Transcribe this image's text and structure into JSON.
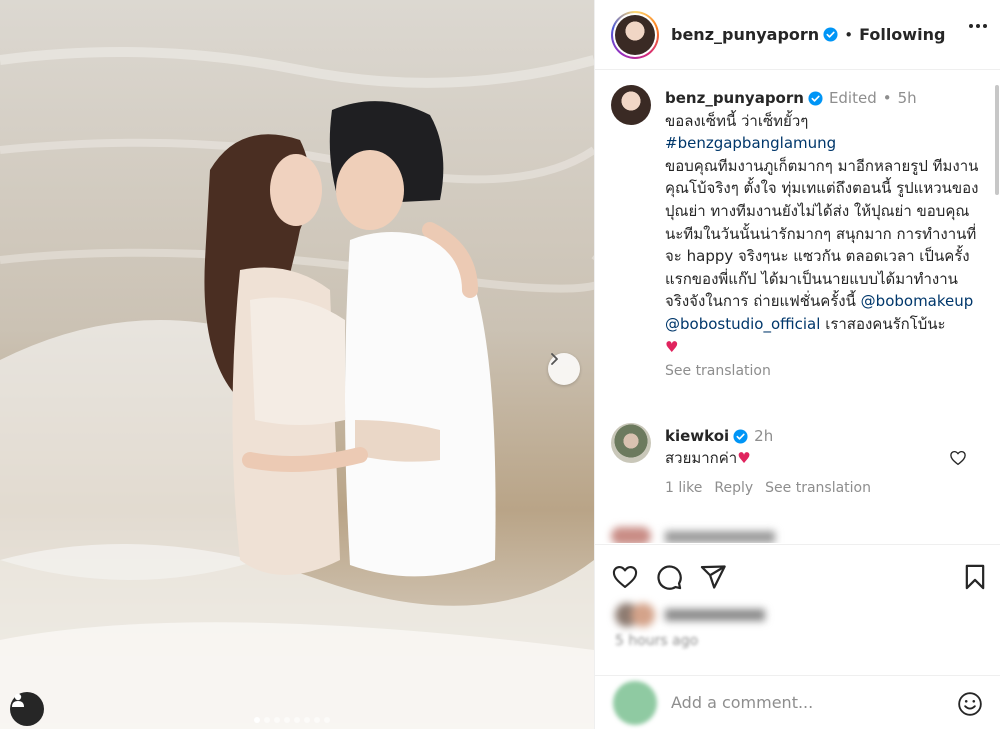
{
  "post": {
    "author": "benz_punyaporn",
    "follow_status": "Following",
    "separator": "•",
    "photo_dots_count": 8,
    "photo_active_dot": 0
  },
  "caption": {
    "username": "benz_punyaporn",
    "edited": "Edited",
    "dot": "•",
    "time": "5h",
    "line1": "ขอลงเซ็ทนี้ ว่าเซ็ทยั้วๆ",
    "hashtag": "#benzgapbanglamung",
    "body": "ขอบคุณทีมงานภูเก็ตมากๆ มาอีกหลายรูป ทีมงานคุณโบ้จริงๆ ตั้งใจ ทุ่มเทแต่ถึงตอนนี้ รูปแหวนของปุณย่า ทางทีมงานยังไม่ได้ส่ง ให้ปุณย่า ขอบคุณนะทีมในวันนั้นน่ารักมากๆ สนุกมาก การทำงานที่จะ happy จริงๆนะ แซวกัน ตลอดเวลา เป็นครั้งแรกของพี่แก๊ป ได้มาเป็นนายแบบได้มาทำงานจริงจังในการ ถ่ายแฟชั่นครั้งนี้",
    "mention1": "@bobomakeup",
    "mention2": "@bobostudio_official",
    "tail": " เราสองคนรักโบ้นะ",
    "heart": "♥",
    "see_translation": "See translation"
  },
  "comment": {
    "username": "kiewkoi",
    "time": "2h",
    "text": "สวยมากค่า",
    "heart": "♥",
    "likes": "1 like",
    "reply": "Reply",
    "see_translation": "See translation"
  },
  "footer": {
    "time_ago": "5 hours ago",
    "add_comment_placeholder": "Add a comment..."
  },
  "colors": {
    "verified": "#0095f6",
    "link": "#00376b",
    "muted": "#8e8e8e",
    "heart": "#e0245e"
  }
}
